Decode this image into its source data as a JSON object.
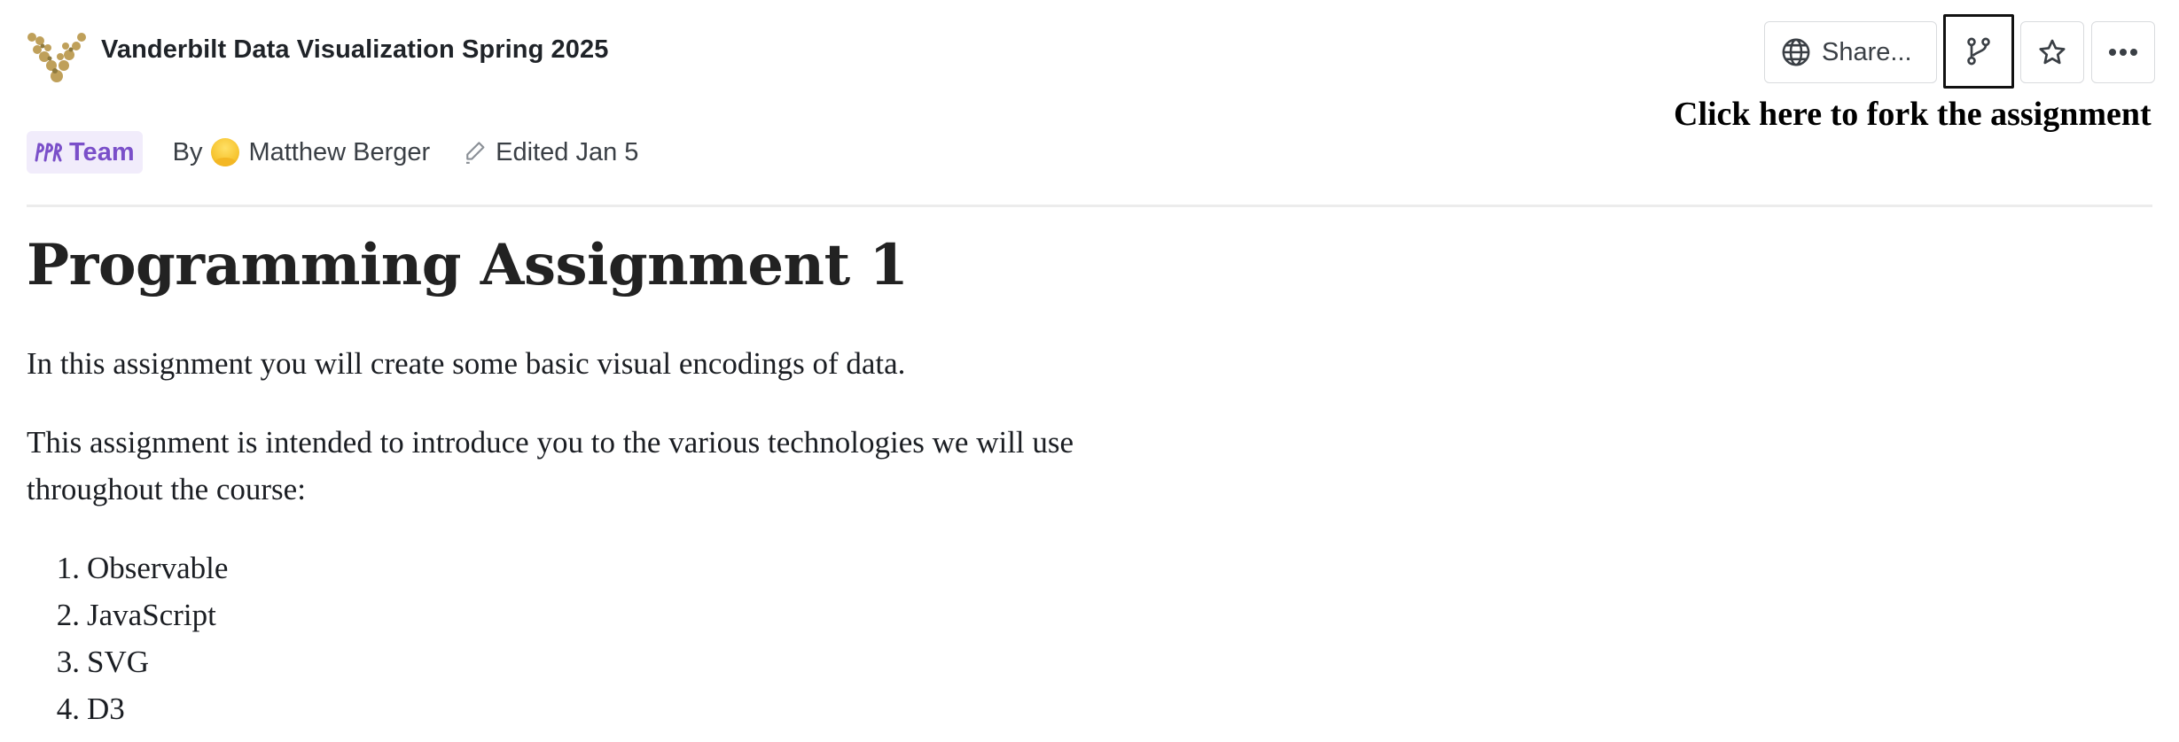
{
  "header": {
    "title": "Vanderbilt Data Visualization Spring 2025",
    "logo_icon": "vanderbilt-v-logo",
    "share_label": "Share...",
    "share_icon": "globe-icon",
    "fork_icon": "fork-icon",
    "star_icon": "star-icon",
    "more_icon": "more-icon"
  },
  "annotation": {
    "text": "Click here to fork the assignment"
  },
  "meta": {
    "team_label": "Team",
    "team_icon": "team-icon",
    "by_label": "By",
    "author": "Matthew Berger",
    "edited": "Edited Jan 5",
    "edit_icon": "pencil-icon"
  },
  "document": {
    "title": "Programming Assignment 1",
    "paragraph1": "In this assignment you will create some basic visual encodings of data.",
    "paragraph2": "This assignment is intended to introduce you to the various technologies we will use throughout the course:",
    "list": [
      {
        "number": "1.",
        "text": "Observable"
      },
      {
        "number": "2.",
        "text": "JavaScript"
      },
      {
        "number": "3.",
        "text": "SVG"
      },
      {
        "number": "4.",
        "text": "D3"
      }
    ]
  },
  "colors": {
    "team_badge_bg": "#f1ecfb",
    "team_badge_text": "#7a4fc9",
    "fork_highlight_border": "#111111"
  }
}
